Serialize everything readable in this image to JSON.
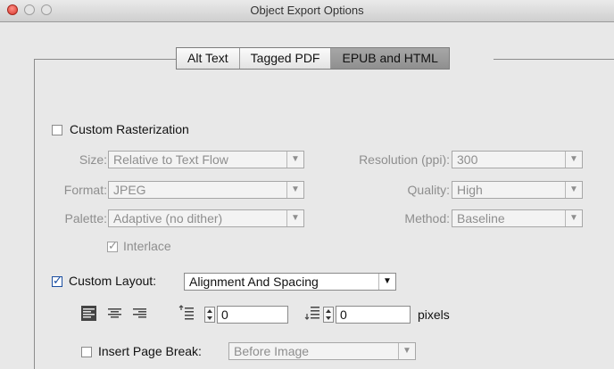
{
  "window": {
    "title": "Object Export Options"
  },
  "tabs": [
    {
      "label": "Alt Text",
      "active": false
    },
    {
      "label": "Tagged PDF",
      "active": false
    },
    {
      "label": "EPUB and HTML",
      "active": true
    }
  ],
  "custom_rasterization": {
    "label": "Custom Rasterization",
    "checked": false
  },
  "size": {
    "label": "Size:",
    "value": "Relative to Text Flow"
  },
  "resolution": {
    "label": "Resolution (ppi):",
    "value": "300"
  },
  "format": {
    "label": "Format:",
    "value": "JPEG"
  },
  "quality": {
    "label": "Quality:",
    "value": "High"
  },
  "palette": {
    "label": "Palette:",
    "value": "Adaptive (no dither)"
  },
  "method": {
    "label": "Method:",
    "value": "Baseline"
  },
  "interlace": {
    "label": "Interlace",
    "checked": true
  },
  "custom_layout": {
    "label": "Custom Layout:",
    "checked": true,
    "value": "Alignment And Spacing"
  },
  "spacing": {
    "before_value": "0",
    "after_value": "0",
    "unit": "pixels"
  },
  "page_break": {
    "label": "Insert Page Break:",
    "checked": false,
    "value": "Before Image"
  },
  "icons": {
    "dropdown_arrow": "▼",
    "check": "✓",
    "align_left": "align-left-icon",
    "align_center": "align-center-icon",
    "align_right": "align-right-icon",
    "space_before": "space-before-icon",
    "space_after": "space-after-icon"
  }
}
